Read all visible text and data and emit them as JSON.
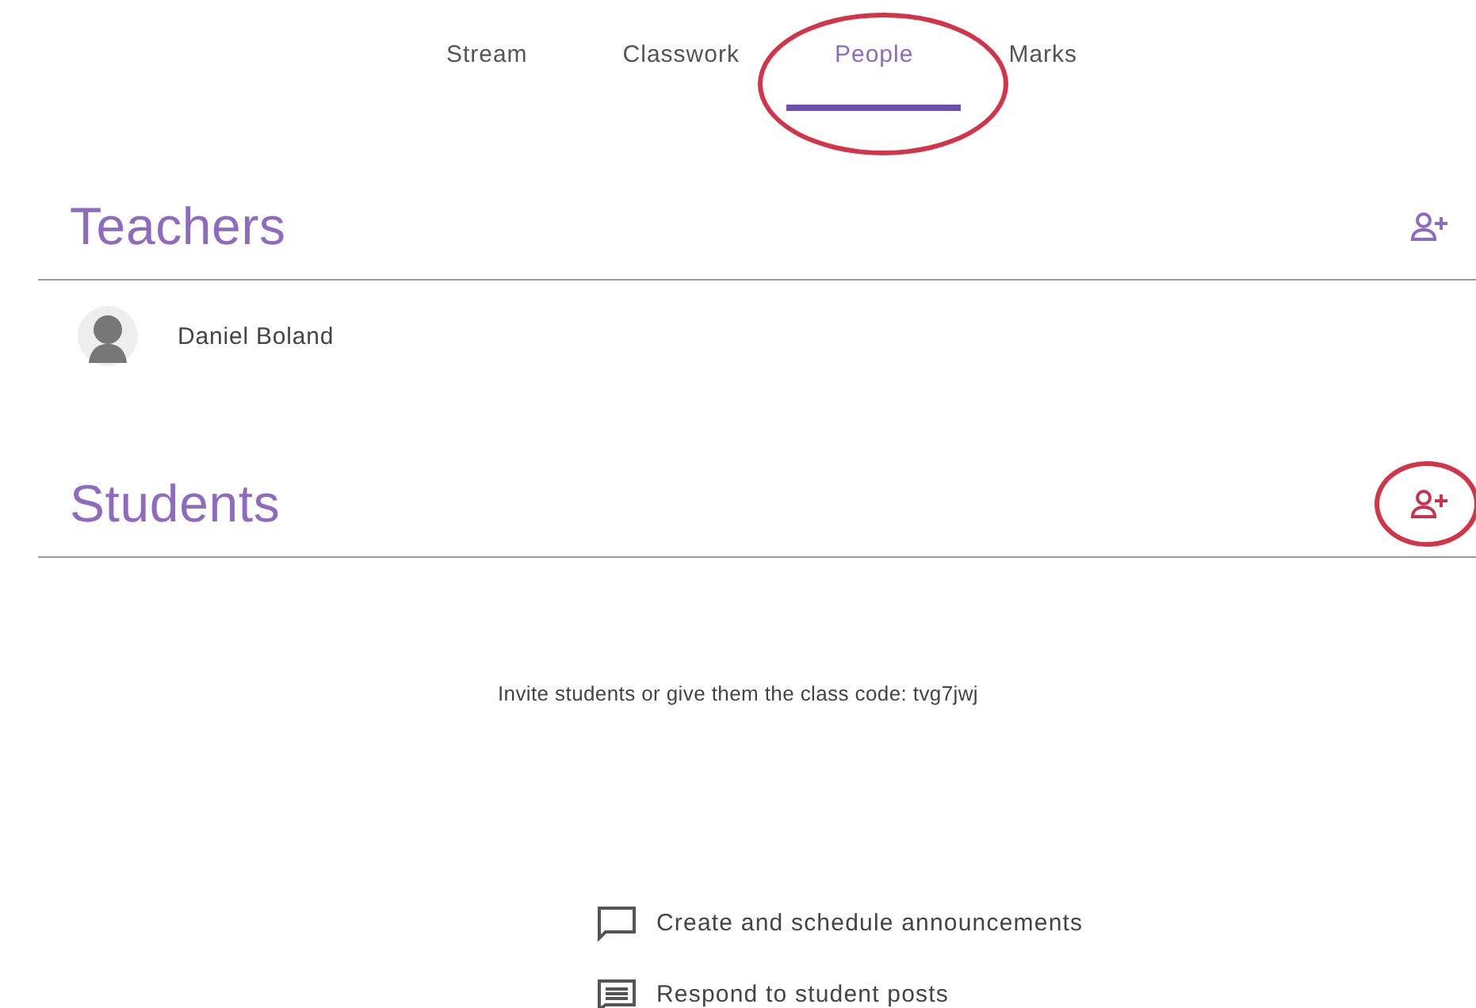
{
  "tabs": [
    {
      "label": "Stream",
      "selected": false,
      "circled": false
    },
    {
      "label": "Classwork",
      "selected": false,
      "circled": false
    },
    {
      "label": "People",
      "selected": true,
      "circled": true
    },
    {
      "label": "Marks",
      "selected": false,
      "circled": false
    }
  ],
  "sections": [
    {
      "title": "Teachers",
      "add_circled": false,
      "people": [
        {
          "name": "Daniel Boland"
        }
      ]
    },
    {
      "title": "Students",
      "add_circled": true,
      "invite": "Invite students or give them the class code: tvg7jwj"
    }
  ],
  "features": [
    {
      "kind": "announcement",
      "label": "Create and schedule announcements"
    },
    {
      "kind": "posts",
      "label": "Respond to student posts"
    }
  ]
}
